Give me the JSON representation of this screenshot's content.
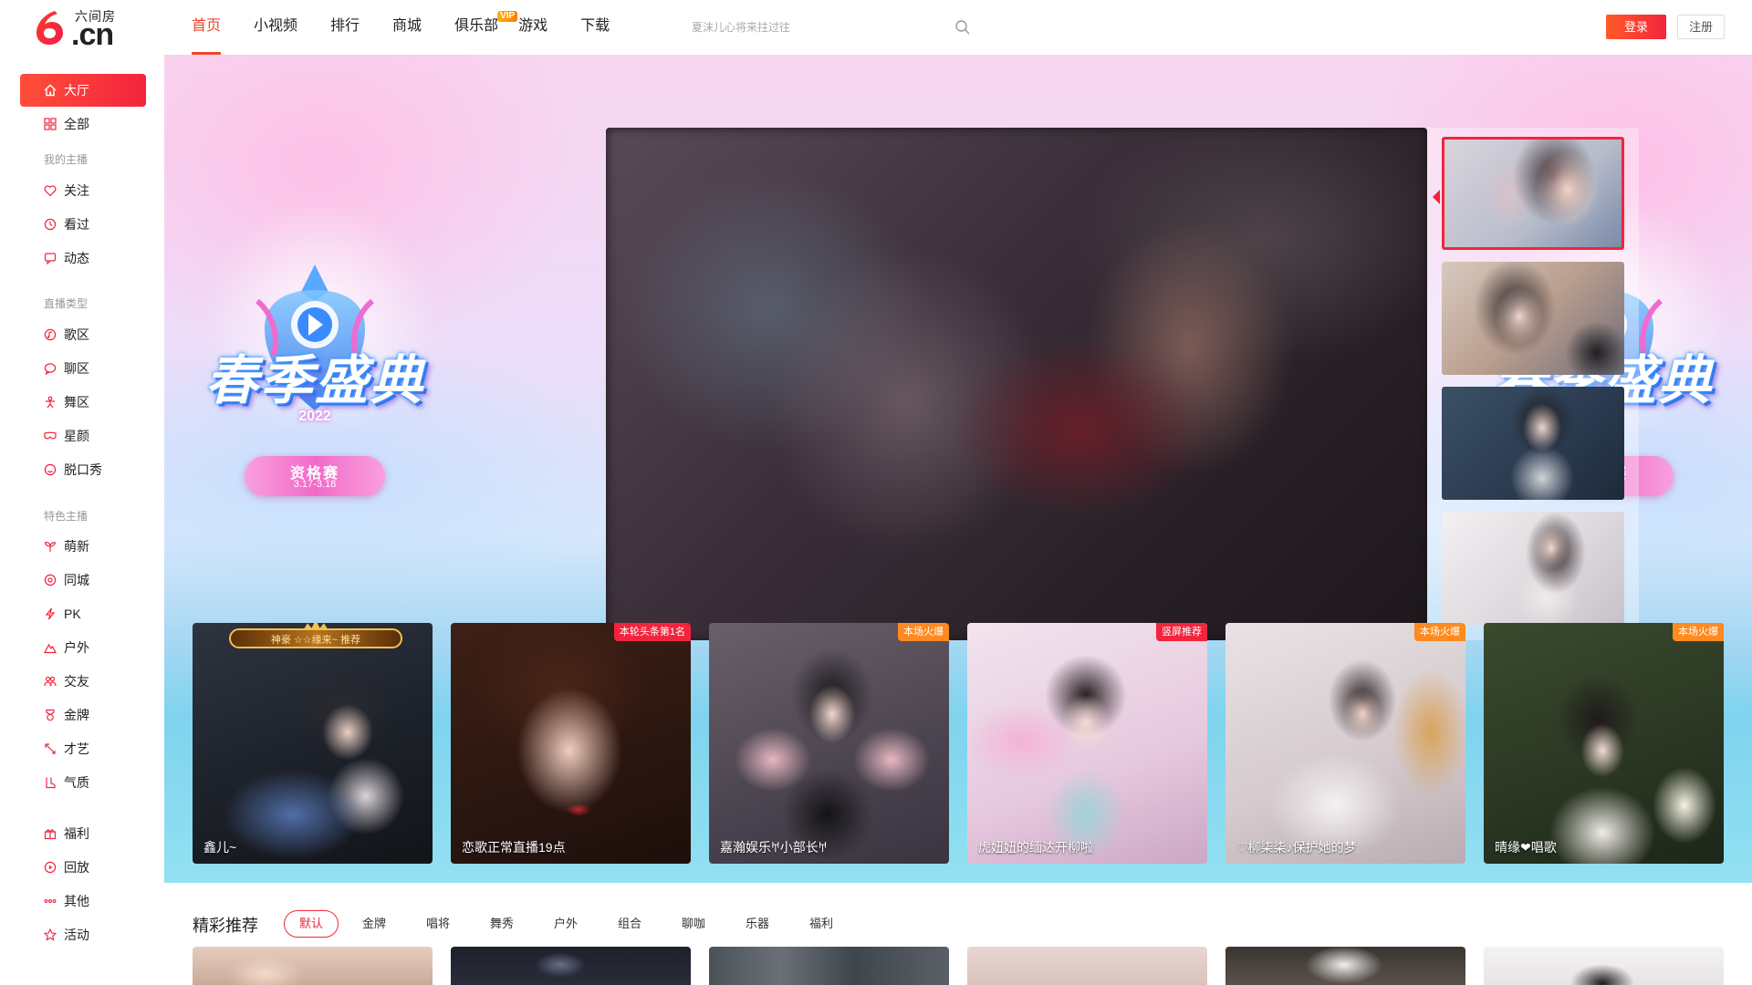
{
  "header": {
    "logo_text": "六间房",
    "logo_domain": ".cn",
    "nav": [
      {
        "label": "首页",
        "active": true
      },
      {
        "label": "小视频"
      },
      {
        "label": "排行"
      },
      {
        "label": "商城"
      },
      {
        "label": "俱乐部",
        "badge": "VIP"
      },
      {
        "label": "游戏"
      },
      {
        "label": "下载"
      }
    ],
    "search_placeholder": "夏沫儿心将来拄过往",
    "login_label": "登录",
    "register_label": "注册"
  },
  "sidebar": {
    "items_top": [
      {
        "label": "大厅",
        "icon": "home-icon",
        "active": true
      },
      {
        "label": "全部",
        "icon": "grid-icon"
      }
    ],
    "group_my": "我的主播",
    "items_my": [
      {
        "label": "关注",
        "icon": "heart-icon"
      },
      {
        "label": "看过",
        "icon": "clock-icon"
      },
      {
        "label": "动态",
        "icon": "chat-icon"
      }
    ],
    "group_type": "直播类型",
    "items_type": [
      {
        "label": "歌区",
        "icon": "music-icon"
      },
      {
        "label": "聊区",
        "icon": "bubble-icon"
      },
      {
        "label": "舞区",
        "icon": "dance-icon"
      },
      {
        "label": "星颜",
        "icon": "mask-icon"
      },
      {
        "label": "脱口秀",
        "icon": "talk-icon"
      }
    ],
    "group_special": "特色主播",
    "items_special": [
      {
        "label": "萌新",
        "icon": "sprout-icon"
      },
      {
        "label": "同城",
        "icon": "location-icon"
      },
      {
        "label": "PK",
        "icon": "lightning-icon"
      },
      {
        "label": "户外",
        "icon": "outdoor-icon"
      },
      {
        "label": "交友",
        "icon": "friends-icon"
      },
      {
        "label": "金牌",
        "icon": "medal-icon"
      },
      {
        "label": "才艺",
        "icon": "talent-icon"
      },
      {
        "label": "气质",
        "icon": "boot-icon"
      }
    ],
    "items_bottom": [
      {
        "label": "福利",
        "icon": "gift-icon"
      },
      {
        "label": "回放",
        "icon": "replay-icon"
      },
      {
        "label": "其他",
        "icon": "more-icon"
      },
      {
        "label": "活动",
        "icon": "star-icon"
      }
    ]
  },
  "hero": {
    "event_title": "春季盛典",
    "event_year": "2022",
    "event_pill_line1": "资格赛",
    "event_pill_line2": "3.17-3.18"
  },
  "featured": [
    {
      "name": "鑫儿~",
      "crown_text": "神豪 ☆☆缘来~ 推荐"
    },
    {
      "name": "恋歌正常直播19点",
      "tag": "本轮头条第1名",
      "tag_color": "#f3243c"
    },
    {
      "name": "嘉瀚娱乐𐀀小部长𐀀",
      "tag": "本场火爆",
      "tag_color": "#ff8a1f"
    },
    {
      "name": "虎妞妞的缅达开柳啦",
      "tag": "竖屏推荐",
      "tag_color": "#f3243c"
    },
    {
      "name": "♡柳柒柒♪保护她的梦",
      "tag": "本场火爆",
      "tag_color": "#ff8a1f"
    },
    {
      "name": "晴缘❤唱歌",
      "tag": "本场火爆",
      "tag_color": "#ff8a1f"
    }
  ],
  "section": {
    "title": "精彩推荐",
    "filters": [
      {
        "label": "默认",
        "active": true
      },
      {
        "label": "金牌"
      },
      {
        "label": "唱将"
      },
      {
        "label": "舞秀"
      },
      {
        "label": "户外"
      },
      {
        "label": "组合"
      },
      {
        "label": "聊咖"
      },
      {
        "label": "乐器"
      },
      {
        "label": "福利"
      }
    ]
  },
  "colors": {
    "accent": "#f3243c",
    "accent_orange": "#ff8a1f",
    "text": "#222222",
    "muted": "#999999"
  }
}
